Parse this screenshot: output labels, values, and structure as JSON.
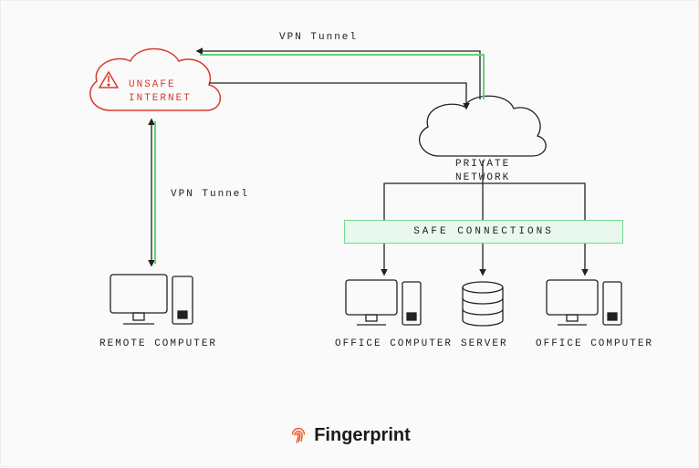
{
  "labels": {
    "vpn_top": "VPN Tunnel",
    "vpn_left": "VPN Tunnel",
    "unsafe_line1": "UNSAFE",
    "unsafe_line2": "INTERNET",
    "private_line1": "PRIVATE",
    "private_line2": "NETWORK",
    "safe_connections": "SAFE CONNECTIONS",
    "remote_computer": "REMOTE COMPUTER",
    "office_computer": "OFFICE COMPUTER",
    "server": "SERVER"
  },
  "brand": "Fingerprint",
  "colors": {
    "danger": "#d93a2b",
    "line": "#222222",
    "tunnel": "#5fd47a",
    "safe_bg": "#e9f8ef",
    "safe_border": "#72d98f"
  }
}
